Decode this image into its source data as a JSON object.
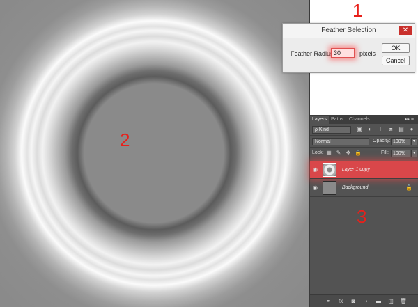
{
  "markers": {
    "one": "1",
    "two": "2",
    "three": "3"
  },
  "dialog": {
    "title": "Feather Selection",
    "close": "✕",
    "radius_label": "Feather Radius:",
    "radius_value": "30",
    "units": "pixels",
    "ok": "OK",
    "cancel": "Cancel"
  },
  "panel": {
    "tabs": [
      {
        "label": "Layers"
      },
      {
        "label": "Paths"
      },
      {
        "label": "Channels"
      }
    ],
    "menu": "▸▸ ≡",
    "kind": "ρ Kind",
    "blend_mode": "Normal",
    "opacity_label": "Opacity:",
    "opacity_value": "100%",
    "lock_label": "Lock:",
    "fill_label": "Fill:",
    "fill_value": "100%",
    "layers": [
      {
        "name": "Layer 1 copy"
      },
      {
        "name": "Background"
      }
    ]
  }
}
